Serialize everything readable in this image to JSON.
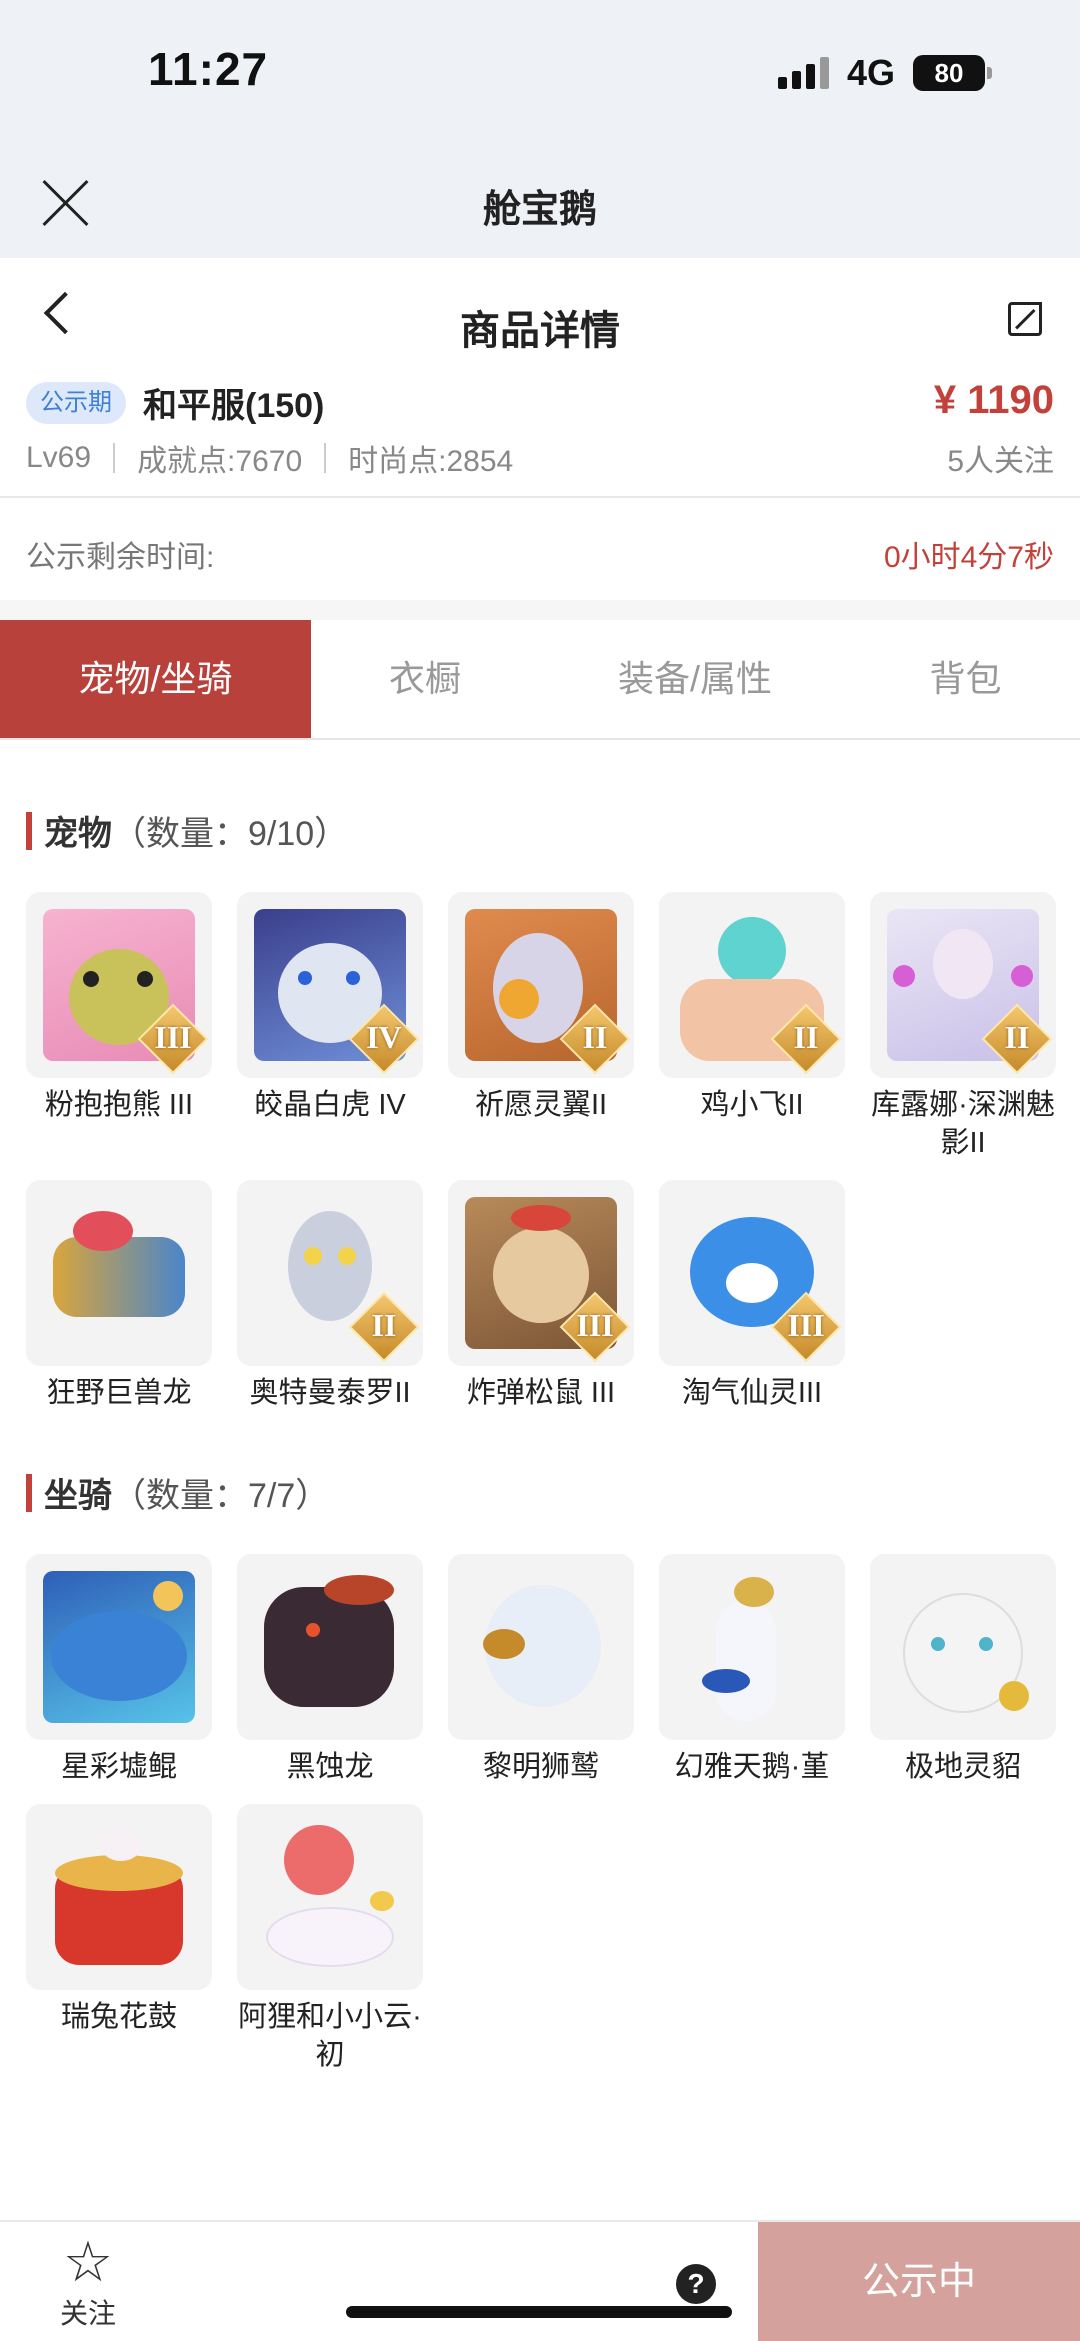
{
  "status_bar": {
    "time": "11:27",
    "network": "4G",
    "battery": "80"
  },
  "app": {
    "title": "舱宝鹅"
  },
  "nav": {
    "title": "商品详情"
  },
  "product": {
    "badge": "公示期",
    "server": "和平服(150)",
    "price": "¥ 1190",
    "level": "Lv69",
    "achievement": "成就点:7670",
    "fashion": "时尚点:2854",
    "followers": "5人关注"
  },
  "timer": {
    "label": "公示剩余时间:",
    "value": "0小时4分7秒"
  },
  "tabs": [
    "宠物/坐骑",
    "衣橱",
    "装备/属性",
    "背包"
  ],
  "pets": {
    "title": "宠物",
    "count": "（数量：9/10）",
    "items": [
      {
        "name": "粉抱抱熊 III",
        "tier": "III"
      },
      {
        "name": "皎晶白虎 IV",
        "tier": "IV"
      },
      {
        "name": "祈愿灵翼II",
        "tier": "II"
      },
      {
        "name": "鸡小飞II",
        "tier": "II"
      },
      {
        "name": "库露娜·深渊魅影II",
        "tier": "II"
      },
      {
        "name": "狂野巨兽龙",
        "tier": ""
      },
      {
        "name": "奥特曼泰罗II",
        "tier": "II"
      },
      {
        "name": "炸弹松鼠 III",
        "tier": "III"
      },
      {
        "name": "淘气仙灵III",
        "tier": "III"
      }
    ]
  },
  "mounts": {
    "title": "坐骑",
    "count": "（数量：7/7）",
    "items": [
      {
        "name": "星彩墟鲲"
      },
      {
        "name": "黑蚀龙"
      },
      {
        "name": "黎明狮鹫"
      },
      {
        "name": "幻雅天鹅·堇"
      },
      {
        "name": "极地灵貂"
      },
      {
        "name": "瑞兔花鼓"
      },
      {
        "name": "阿狸和小小云·初"
      }
    ]
  },
  "bottom": {
    "follow_label": "关注",
    "cta": "公示中",
    "help": "?"
  },
  "colors": {
    "accent": "#b8423b",
    "price": "#c2413a",
    "badge_bg": "#dde9fa",
    "cta_bg": "#d4a19c"
  }
}
